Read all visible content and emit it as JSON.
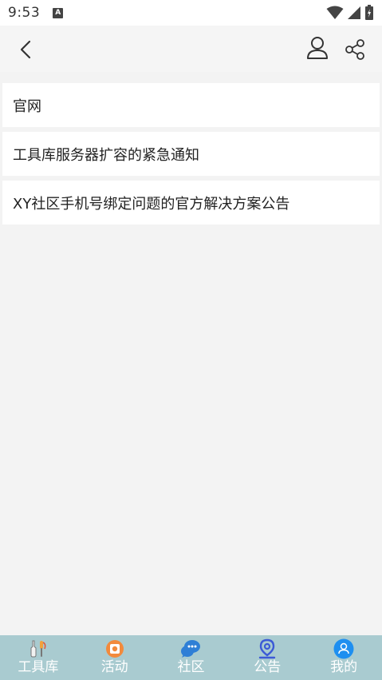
{
  "status_bar": {
    "time": "9:53",
    "notification_badge": "A",
    "icons": [
      "wifi-icon",
      "signal-icon",
      "battery-icon"
    ]
  },
  "header": {
    "back_icon": "chevron-left-icon",
    "user_icon": "user-icon",
    "share_icon": "share-icon"
  },
  "list": {
    "items": [
      {
        "label": "官网"
      },
      {
        "label": "工具库服务器扩容的紧急通知"
      },
      {
        "label": "XY社区手机号绑定问题的官方解决方案公告"
      }
    ]
  },
  "tabbar": {
    "items": [
      {
        "label": "工具库",
        "icon": "tools-icon"
      },
      {
        "label": "活动",
        "icon": "activity-icon"
      },
      {
        "label": "社区",
        "icon": "community-chat-icon"
      },
      {
        "label": "公告",
        "icon": "location-pin-icon"
      },
      {
        "label": "我的",
        "icon": "profile-icon"
      }
    ]
  },
  "colors": {
    "tabbar_bg": "#a9cbd0",
    "background": "#f3f3f3",
    "item_bg": "#ffffff",
    "activity_orange": "#f28a3c",
    "community_blue": "#2f7fd6",
    "profile_blue": "#1e8ff0"
  }
}
